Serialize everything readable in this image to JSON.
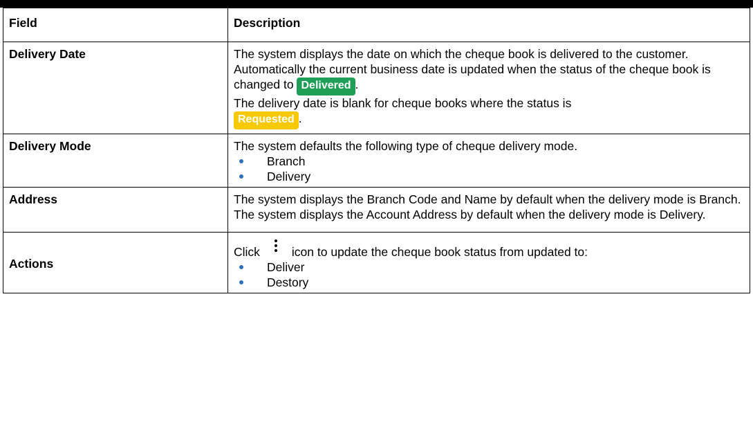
{
  "table": {
    "headers": {
      "field": "Field",
      "description": "Description"
    },
    "rows": {
      "delivery_date": {
        "field": "Delivery Date",
        "text1": "The system displays the date on which the cheque book is delivered to the customer. Automatically the current business date is updated when the status of the cheque book is changed to",
        "badge_delivered": "Delivered",
        "text2": "The delivery date is blank for cheque books where the status is",
        "badge_requested": "Requested",
        "period": "."
      },
      "delivery_mode": {
        "field": "Delivery Mode",
        "text": "The system defaults the following type of cheque delivery mode.",
        "items": [
          "Branch",
          "Delivery"
        ]
      },
      "address": {
        "field": "Address",
        "text1": "The system displays the Branch Code and Name by default when the delivery mode is Branch.",
        "text2": "The system displays the Account Address by default when the delivery mode is Delivery."
      },
      "actions": {
        "field": "Actions",
        "click": "Click",
        "icon": "kebab-menu-icon",
        "text": "icon to update the cheque book status from updated to:",
        "items": [
          "Deliver",
          "Destory"
        ]
      }
    }
  },
  "colors": {
    "delivered_badge": "#1e9e57",
    "requested_badge": "#f8c800",
    "bullet": "#2f6fb6"
  }
}
